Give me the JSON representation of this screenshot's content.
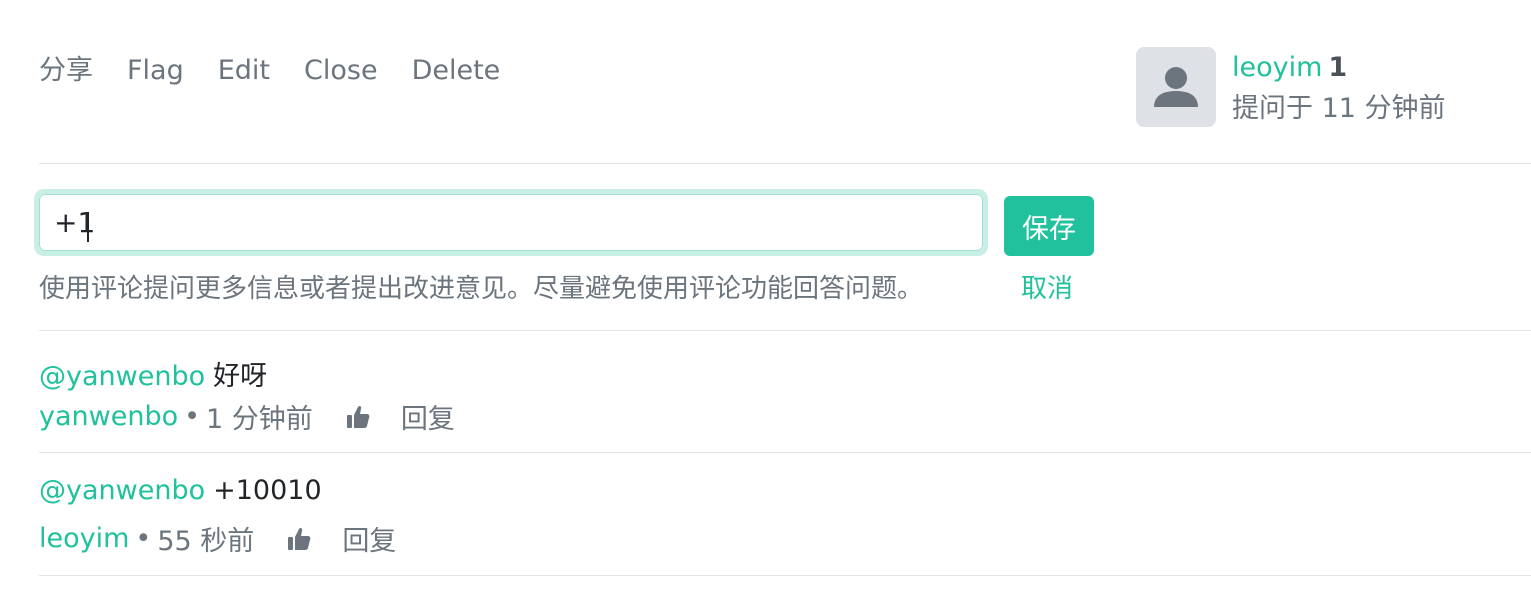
{
  "actions": [
    "分享",
    "Flag",
    "Edit",
    "Close",
    "Delete"
  ],
  "author": {
    "name": "leoyim",
    "reputation": "1",
    "asked": "提问于 11 分钟前",
    "avatar_icon": "user-icon"
  },
  "comment_form": {
    "value": "+1",
    "save_label": "保存",
    "cancel_label": "取消",
    "hint": "使用评论提问更多信息或者提出改进意见。尽量避免使用评论功能回答问题。"
  },
  "comments": [
    {
      "mention": "@yanwenbo",
      "text": "好呀",
      "user": "yanwenbo",
      "time": "1 分钟前",
      "reply": "回复"
    },
    {
      "mention": "@yanwenbo",
      "text": "+10010",
      "user": "leoyim",
      "time": "55 秒前",
      "reply": "回复"
    }
  ],
  "colors": {
    "accent": "#20c19c",
    "muted": "#6c757d",
    "divider": "#e3e6e9"
  }
}
